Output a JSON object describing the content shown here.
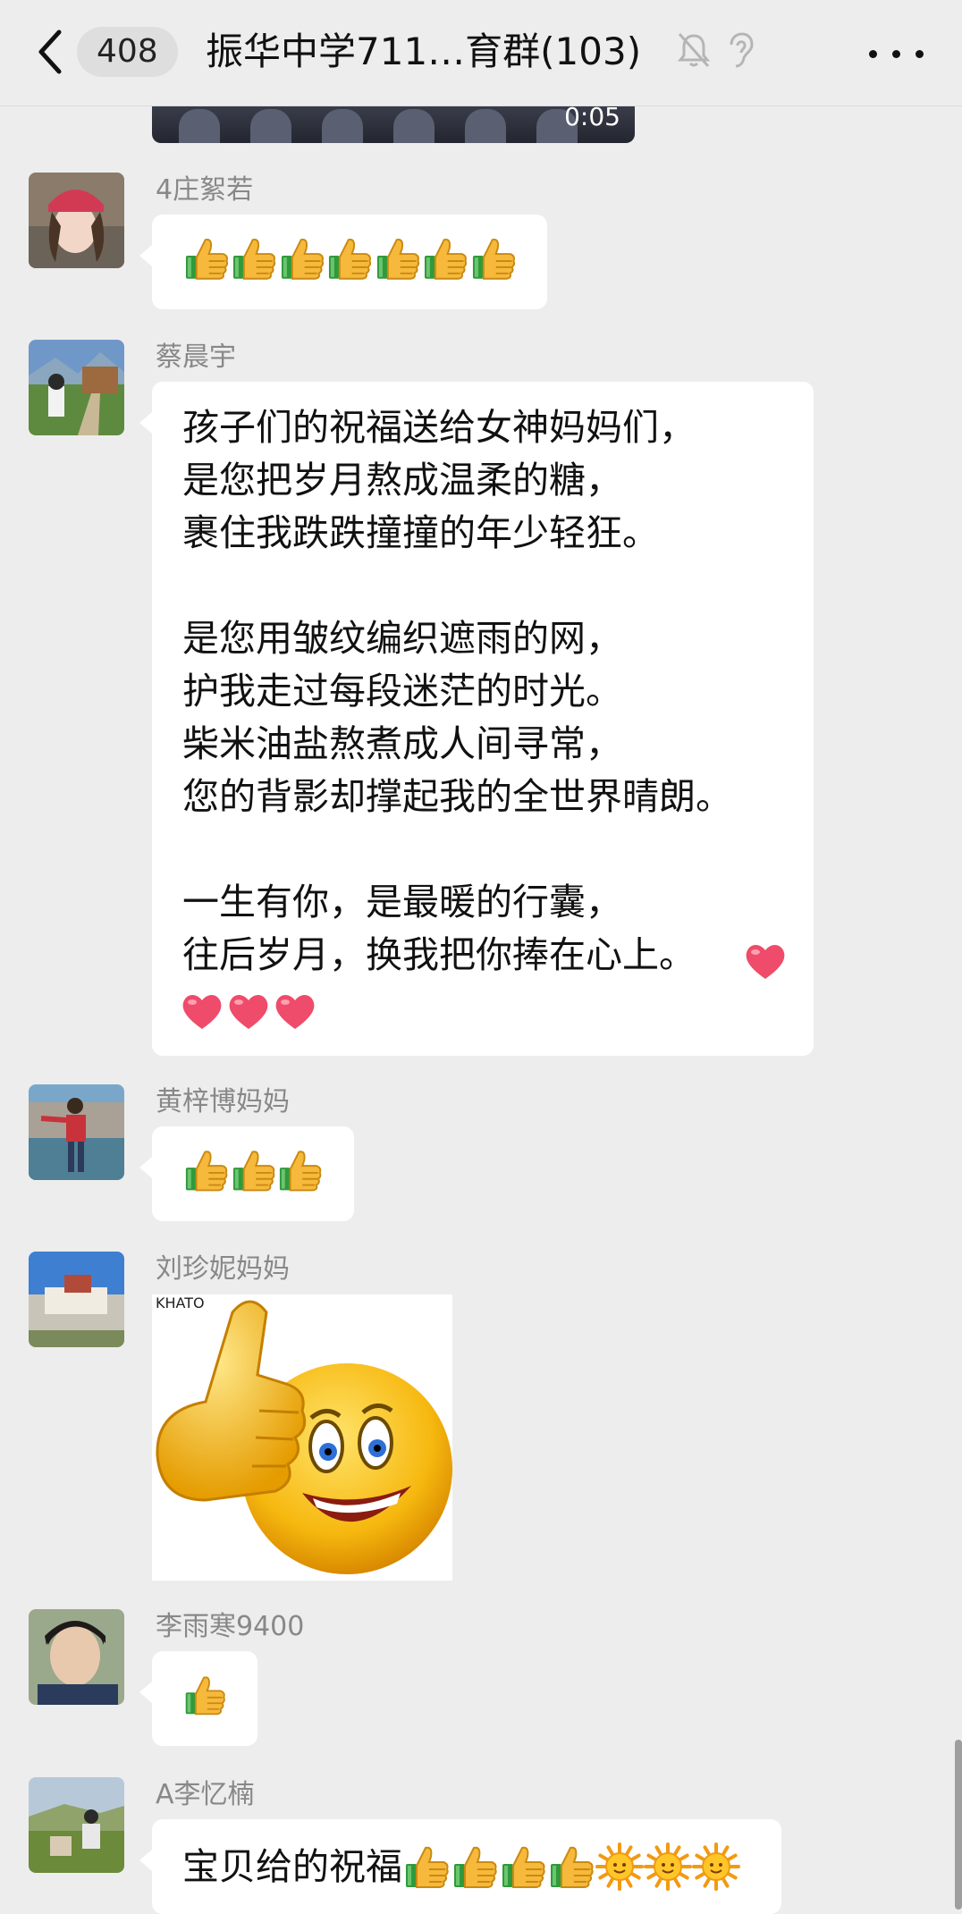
{
  "header": {
    "unread_count": "408",
    "title": "振华中学711…育群(103)"
  },
  "video": {
    "duration": "0:05"
  },
  "messages": [
    {
      "sender": "4庄絮若",
      "type": "emoji",
      "thumbs": 7
    },
    {
      "sender": "蔡晨宇",
      "type": "text",
      "text": "孩子们的祝福送给女神妈妈们，\n是您把岁月熬成温柔的糖，\n裹住我跌跌撞撞的年少轻狂。\n\n是您用皱纹编织遮雨的网，\n护我走过每段迷茫的时光。\n柴米油盐熬煮成人间寻常，\n您的背影却撑起我的全世界晴朗。\n\n一生有你，是最暖的行囊，\n往后岁月，换我把你捧在心上。",
      "hearts": 4
    },
    {
      "sender": "黄梓博妈妈",
      "type": "emoji",
      "thumbs": 3
    },
    {
      "sender": "刘珍妮妈妈",
      "type": "sticker",
      "watermark": "KHATO"
    },
    {
      "sender": "李雨寒9400",
      "type": "emoji",
      "thumbs": 1
    },
    {
      "sender": "A李忆楠",
      "type": "text",
      "text": "宝贝给的祝福",
      "thumbs": 4,
      "suns": 3
    }
  ]
}
